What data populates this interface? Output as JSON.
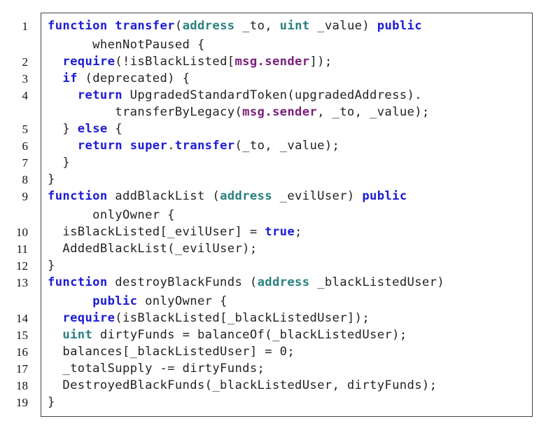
{
  "lines": [
    {
      "n": "1",
      "tokens": [
        [
          "kw",
          "function"
        ],
        [
          "p",
          " "
        ],
        [
          "kw",
          "transfer"
        ],
        [
          "p",
          "("
        ],
        [
          "ty",
          "address"
        ],
        [
          "p",
          " _to, "
        ],
        [
          "ty",
          "uint"
        ],
        [
          "p",
          " _value) "
        ],
        [
          "kw",
          "public"
        ]
      ]
    },
    {
      "n": "",
      "tokens": [
        [
          "p",
          "      whenNotPaused {"
        ]
      ]
    },
    {
      "n": "2",
      "tokens": [
        [
          "p",
          "  "
        ],
        [
          "kw",
          "require"
        ],
        [
          "p",
          "(!isBlackListed["
        ],
        [
          "gl",
          "msg.sender"
        ],
        [
          "p",
          "]);"
        ]
      ]
    },
    {
      "n": "3",
      "tokens": [
        [
          "p",
          "  "
        ],
        [
          "kw",
          "if"
        ],
        [
          "p",
          " (deprecated) {"
        ]
      ]
    },
    {
      "n": "4",
      "tokens": [
        [
          "p",
          "    "
        ],
        [
          "kw",
          "return"
        ],
        [
          "p",
          " UpgradedStandardToken(upgradedAddress)."
        ]
      ]
    },
    {
      "n": "",
      "tokens": [
        [
          "p",
          "         transferByLegacy("
        ],
        [
          "gl",
          "msg.sender"
        ],
        [
          "p",
          ", _to, _value);"
        ]
      ]
    },
    {
      "n": "5",
      "tokens": [
        [
          "p",
          "  } "
        ],
        [
          "kw",
          "else"
        ],
        [
          "p",
          " {"
        ]
      ]
    },
    {
      "n": "6",
      "tokens": [
        [
          "p",
          "    "
        ],
        [
          "kw",
          "return"
        ],
        [
          "p",
          " "
        ],
        [
          "kw",
          "super"
        ],
        [
          "p",
          "."
        ],
        [
          "kw",
          "transfer"
        ],
        [
          "p",
          "(_to, _value);"
        ]
      ]
    },
    {
      "n": "7",
      "tokens": [
        [
          "p",
          "  }"
        ]
      ]
    },
    {
      "n": "8",
      "tokens": [
        [
          "p",
          "}"
        ]
      ]
    },
    {
      "n": "9",
      "tokens": [
        [
          "kw",
          "function"
        ],
        [
          "p",
          " addBlackList ("
        ],
        [
          "ty",
          "address"
        ],
        [
          "p",
          " _evilUser) "
        ],
        [
          "kw",
          "public"
        ]
      ]
    },
    {
      "n": "",
      "tokens": [
        [
          "p",
          "      onlyOwner {"
        ]
      ]
    },
    {
      "n": "10",
      "tokens": [
        [
          "p",
          "  isBlackListed[_evilUser] = "
        ],
        [
          "kw",
          "true"
        ],
        [
          "p",
          ";"
        ]
      ]
    },
    {
      "n": "11",
      "tokens": [
        [
          "p",
          "  AddedBlackList(_evilUser);"
        ]
      ]
    },
    {
      "n": "12",
      "tokens": [
        [
          "p",
          "}"
        ]
      ]
    },
    {
      "n": "13",
      "tokens": [
        [
          "kw",
          "function"
        ],
        [
          "p",
          " destroyBlackFunds ("
        ],
        [
          "ty",
          "address"
        ],
        [
          "p",
          " _blackListedUser)"
        ]
      ]
    },
    {
      "n": "",
      "tokens": [
        [
          "p",
          "      "
        ],
        [
          "kw",
          "public"
        ],
        [
          "p",
          " onlyOwner {"
        ]
      ]
    },
    {
      "n": "14",
      "tokens": [
        [
          "p",
          "  "
        ],
        [
          "kw",
          "require"
        ],
        [
          "p",
          "(isBlackListed[_blackListedUser]);"
        ]
      ]
    },
    {
      "n": "15",
      "tokens": [
        [
          "p",
          "  "
        ],
        [
          "ty",
          "uint"
        ],
        [
          "p",
          " dirtyFunds = balanceOf(_blackListedUser);"
        ]
      ]
    },
    {
      "n": "16",
      "tokens": [
        [
          "p",
          "  balances[_blackListedUser] = 0;"
        ]
      ]
    },
    {
      "n": "17",
      "tokens": [
        [
          "p",
          "  _totalSupply -= dirtyFunds;"
        ]
      ]
    },
    {
      "n": "18",
      "tokens": [
        [
          "p",
          "  DestroyedBlackFunds(_blackListedUser, dirtyFunds);"
        ]
      ]
    },
    {
      "n": "19",
      "tokens": [
        [
          "p",
          "}"
        ]
      ]
    }
  ]
}
